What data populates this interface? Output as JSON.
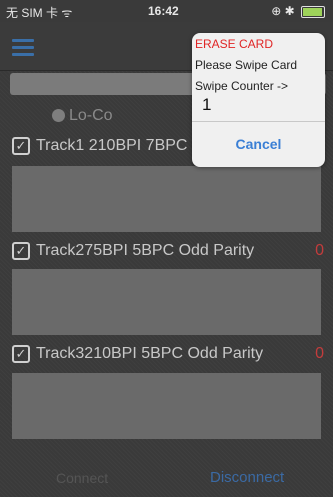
{
  "status_bar": {
    "carrier": "无 SIM 卡 ᯤ",
    "time": "16:42",
    "right": "⊕ ✱",
    "battery_icon": "battery-icon"
  },
  "nav": {
    "menu_icon": "hamburger-menu-icon"
  },
  "radio": {
    "label": "Lo-Co"
  },
  "tracks": [
    {
      "label": "Track1 210BPI 7BPC",
      "count": ""
    },
    {
      "label": "Track275BPI 5BPC Odd Parity",
      "count": "0"
    },
    {
      "label": "Track3210BPI 5BPC Odd Parity",
      "count": "0"
    }
  ],
  "bottom": {
    "connect": "Connect",
    "disconnect": "Disconnect"
  },
  "popup": {
    "title": "ERASE CARD",
    "line1": "Please Swipe Card",
    "line2": "Swipe Counter ->",
    "counter": "1",
    "cancel": "Cancel"
  },
  "colors": {
    "accent_blue": "#3a7fd5",
    "alert_red": "#e02525"
  }
}
